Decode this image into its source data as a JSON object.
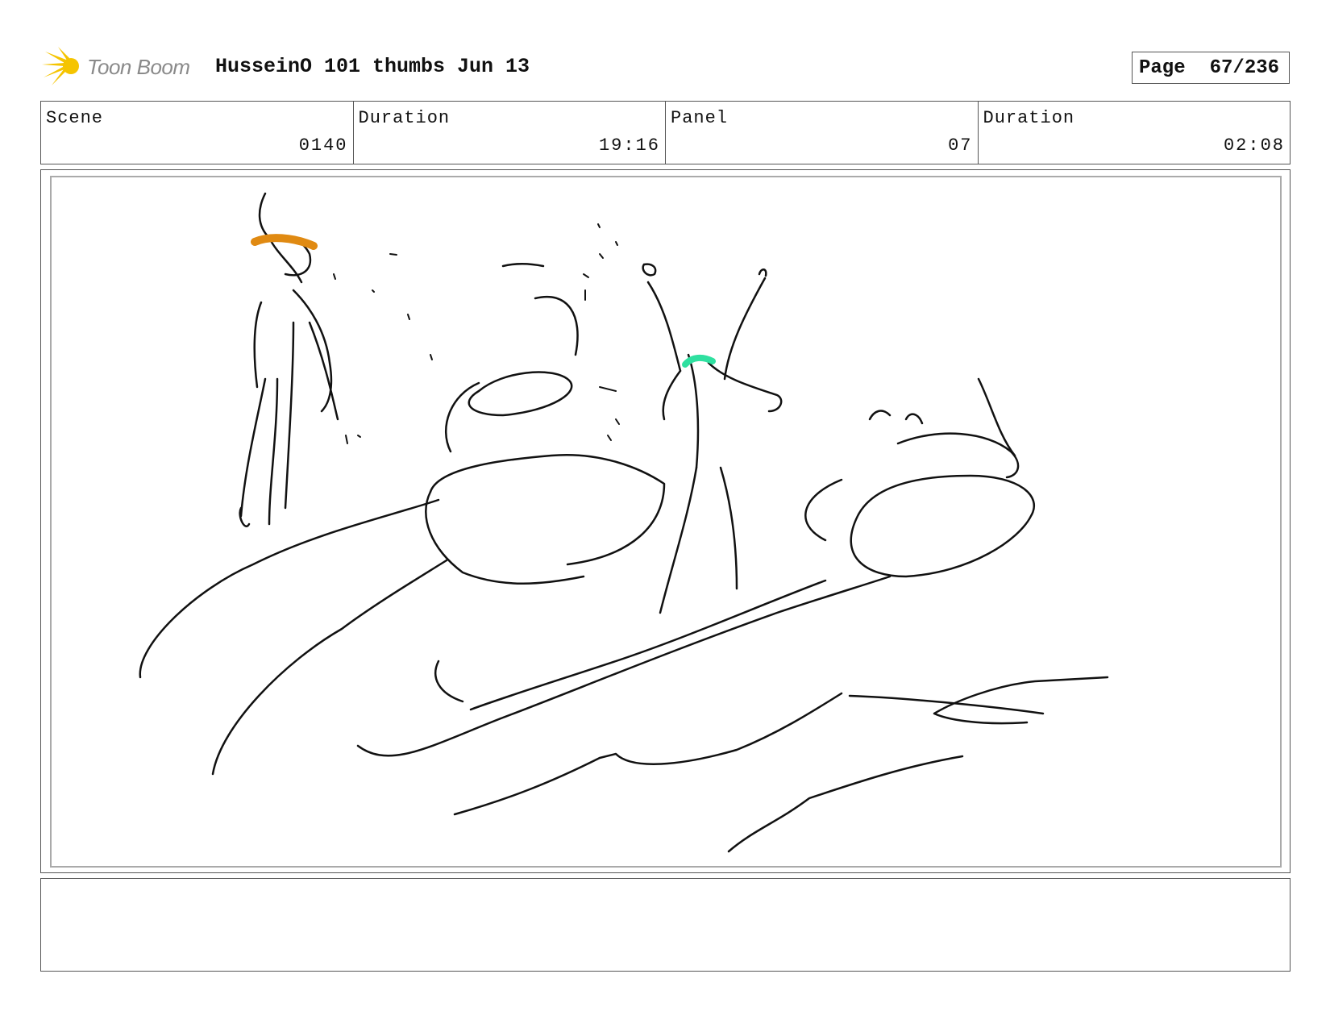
{
  "header": {
    "logo_text": "Toon Boom",
    "logo_accent": "#f5c400",
    "title": "HusseinO 101 thumbs Jun 13",
    "page_label": "Page",
    "page_value": "67/236"
  },
  "info": {
    "scene_label": "Scene",
    "scene_value": "0140",
    "scene_duration_label": "Duration",
    "scene_duration_value": "19:16",
    "panel_label": "Panel",
    "panel_value": "07",
    "panel_duration_label": "Duration",
    "panel_duration_value": "02:08"
  },
  "sketch": {
    "stroke_color": "#111111",
    "headband_left_color": "#e08a12",
    "headband_right_color": "#2fe0a0"
  },
  "notes": {
    "text": ""
  }
}
